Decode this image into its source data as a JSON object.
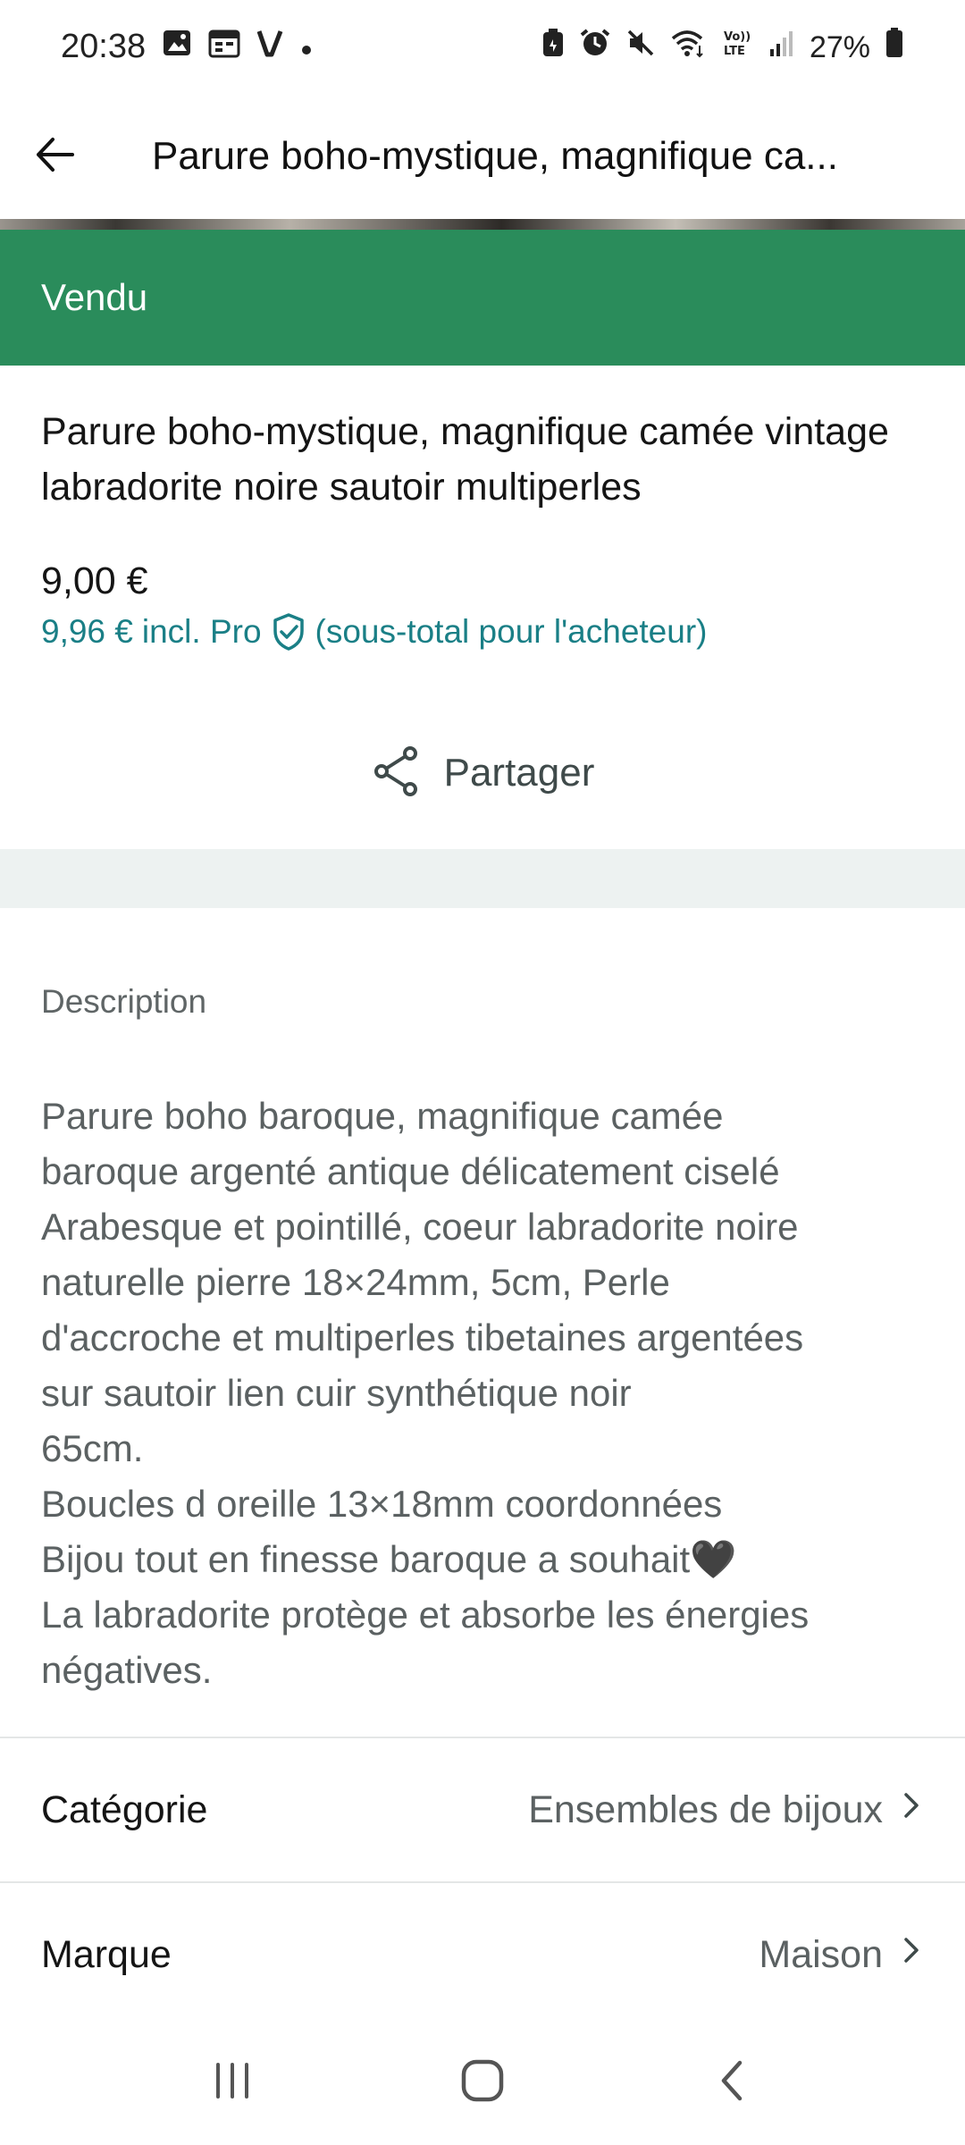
{
  "status_bar": {
    "time": "20:38",
    "battery": "27%",
    "left_icons": [
      "image-icon",
      "calendar-icon",
      "v-app-icon",
      "dot-icon"
    ],
    "right_icons": [
      "battery-saver-icon",
      "alarm-icon",
      "mute-icon",
      "wifi-icon",
      "volte-icon",
      "signal-icon",
      "battery-icon"
    ],
    "volte_label": "VoLTE"
  },
  "app_bar": {
    "title": "Parure boho-mystique, magnifique ca..."
  },
  "banner": {
    "label": "Vendu",
    "color": "#2a8c5b"
  },
  "item": {
    "title": "Parure boho-mystique, magnifique camée vintage labradorite noire sautoir multiperles",
    "price": "9,00 €",
    "pro_price": "9,96 €",
    "pro_label": "incl. Pro",
    "pro_note": "(sous-total pour l'acheteur)",
    "accent_color": "#1a7f86"
  },
  "share": {
    "label": "Partager"
  },
  "description": {
    "heading": "Description",
    "lines": [
      "Parure boho baroque, magnifique camée",
      "baroque argenté antique délicatement ciselé",
      "Arabesque et pointillé, coeur labradorite noire",
      "naturelle pierre 18×24mm, 5cm, Perle",
      "d'accroche et multiperles tibetaines argentées",
      "sur sautoir lien cuir synthétique noir",
      "65cm.",
      "Boucles d oreille 13×18mm coordonnées",
      "Bijou tout en finesse baroque a souhait🖤",
      "La labradorite protège et absorbe les énergies",
      "négatives."
    ]
  },
  "attributes": [
    {
      "label": "Catégorie",
      "value": "Ensembles de bijoux"
    },
    {
      "label": "Marque",
      "value": "Maison"
    }
  ],
  "nav_bar": {
    "icons": [
      "recent-apps-icon",
      "home-icon",
      "back-nav-icon"
    ]
  }
}
